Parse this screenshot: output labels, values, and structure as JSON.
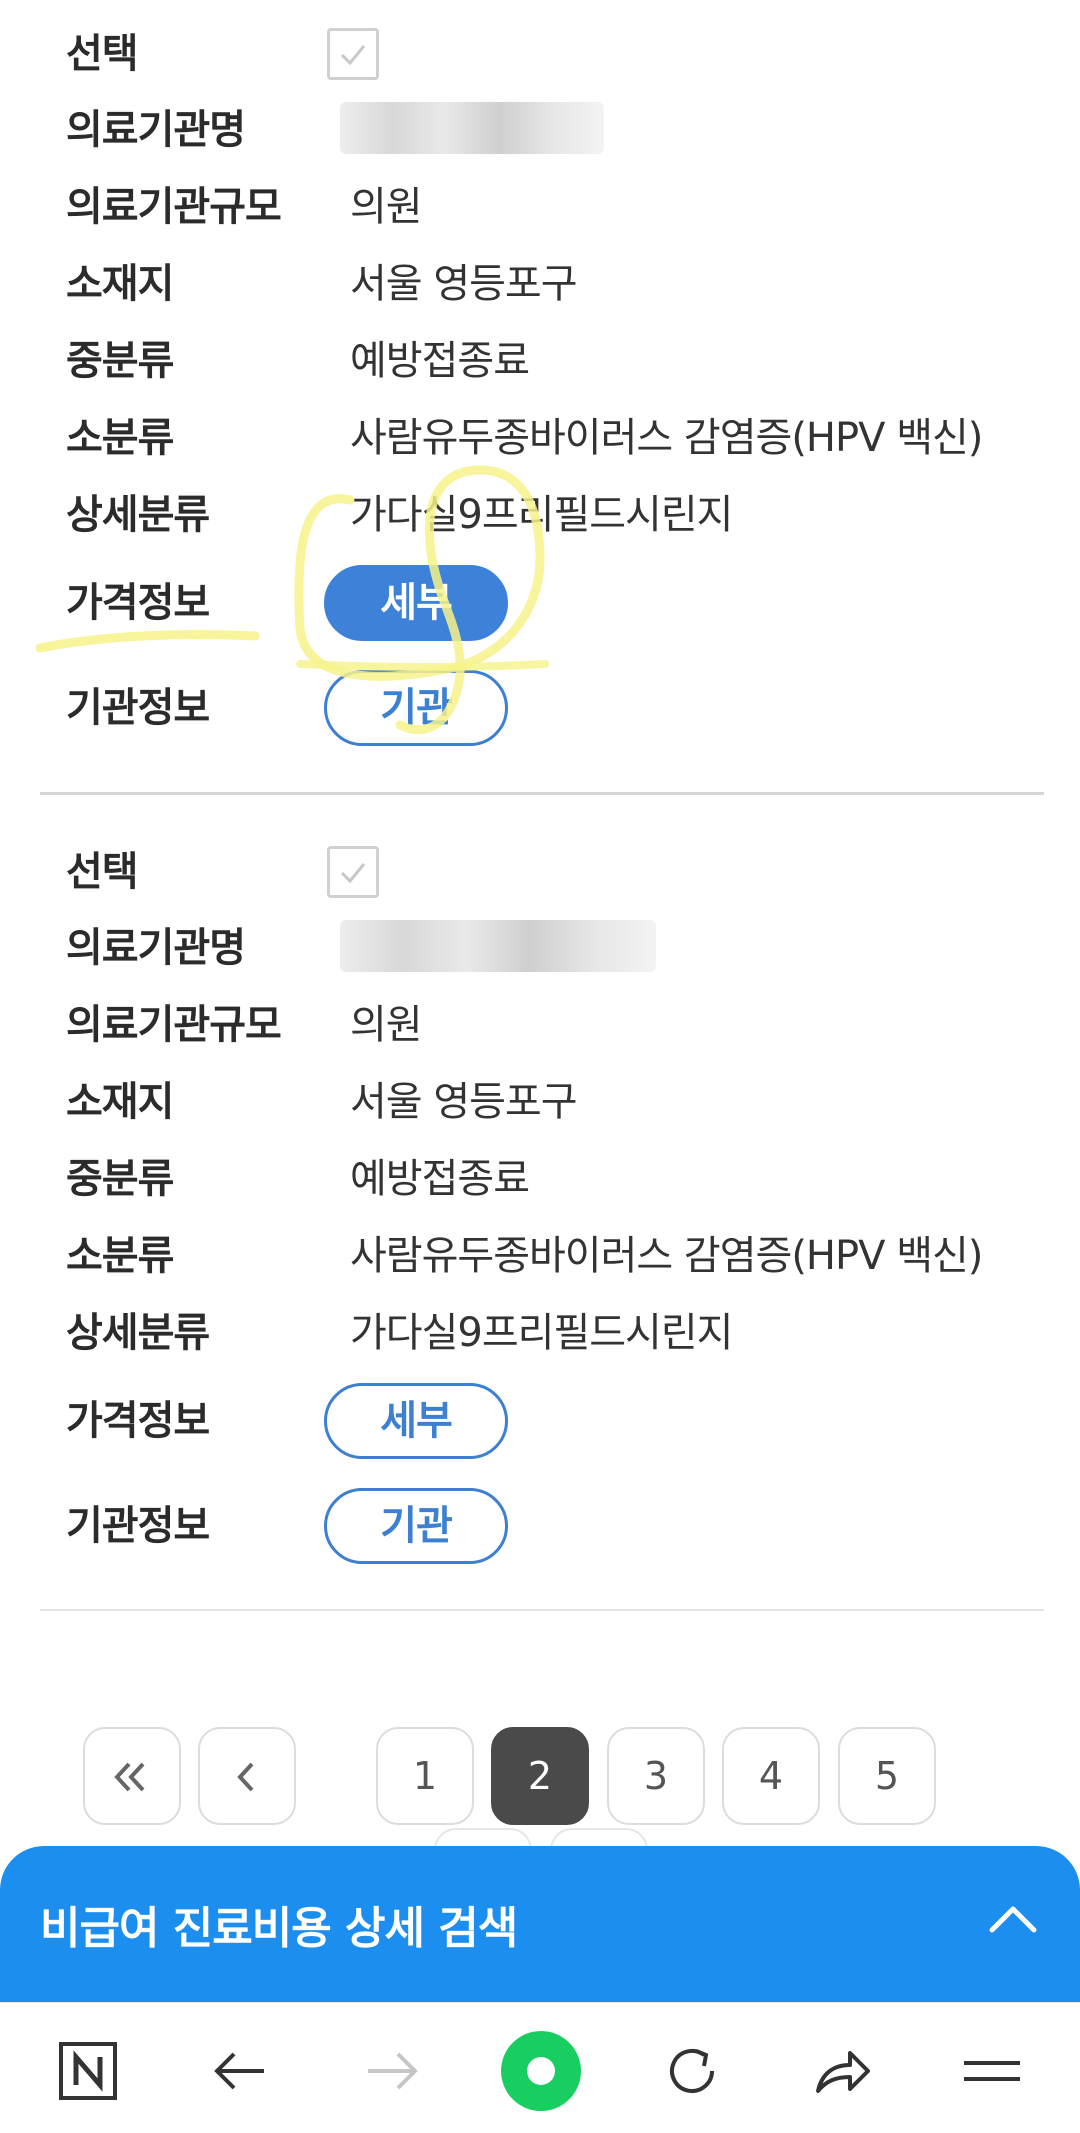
{
  "records": [
    {
      "select_label": "선택",
      "name_label": "의료기관명",
      "scale_label": "의료기관규모",
      "scale_value": "의원",
      "location_label": "소재지",
      "location_value": "서울 영등포구",
      "mid_category_label": "중분류",
      "mid_category_value": "예방접종료",
      "sub_category_label": "소분류",
      "sub_category_value": "사람유두종바이러스 감염증(HPV 백신)",
      "detail_category_label": "상세분류",
      "detail_category_value": "가다실9프리필드시린지",
      "price_info_label": "가격정보",
      "price_button": "세부",
      "institution_info_label": "기관정보",
      "institution_button": "기관"
    },
    {
      "select_label": "선택",
      "name_label": "의료기관명",
      "scale_label": "의료기관규모",
      "scale_value": "의원",
      "location_label": "소재지",
      "location_value": "서울 영등포구",
      "mid_category_label": "중분류",
      "mid_category_value": "예방접종료",
      "sub_category_label": "소분류",
      "sub_category_value": "사람유두종바이러스 감염증(HPV 백신)",
      "detail_category_label": "상세분류",
      "detail_category_value": "가다실9프리필드시린지",
      "price_info_label": "가격정보",
      "price_button": "세부",
      "institution_info_label": "기관정보",
      "institution_button": "기관"
    }
  ],
  "pagination": {
    "first_symbol": "«",
    "prev_symbol": "‹",
    "pages": [
      "1",
      "2",
      "3",
      "4",
      "5"
    ],
    "current_page": "2"
  },
  "search_panel": {
    "title": "비급여 진료비용 상세 검색",
    "toggle_icon": "chevron-up-icon"
  },
  "browser_toolbar": {
    "icons": [
      "naver-n-icon",
      "back-arrow-icon",
      "forward-arrow-icon",
      "home-circle-icon",
      "refresh-icon",
      "share-icon",
      "menu-icon"
    ]
  },
  "colors": {
    "accent_blue": "#3d82d8",
    "search_bar_blue": "#1c8ef0",
    "home_green": "#19ce60",
    "marker_yellow": "#f6f28a",
    "active_page": "#4a4a4a"
  }
}
